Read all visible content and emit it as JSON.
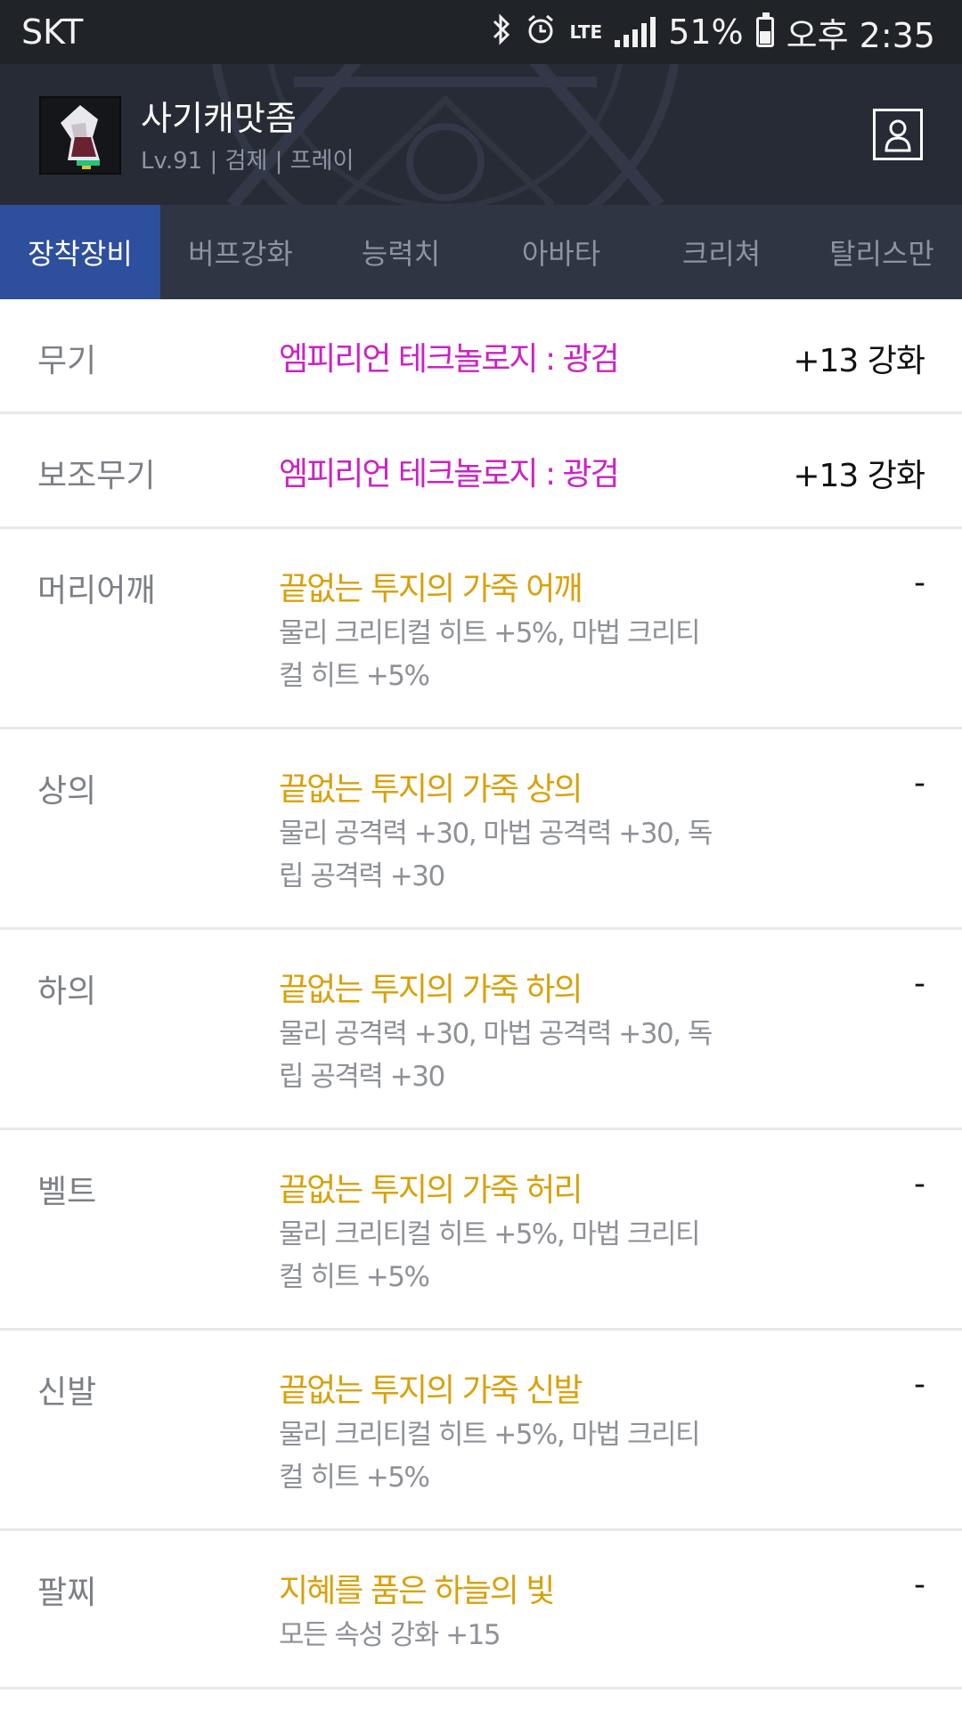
{
  "status_bar": {
    "carrier": "SKT",
    "network": "LTE",
    "battery": "51%",
    "time": "오후 2:35"
  },
  "header": {
    "character_name": "사기캐맛좀",
    "character_info": "Lv.91 | 검제 | 프레이"
  },
  "tabs": [
    {
      "label": "장착장비",
      "active": true
    },
    {
      "label": "버프강화",
      "active": false
    },
    {
      "label": "능력치",
      "active": false
    },
    {
      "label": "아바타",
      "active": false
    },
    {
      "label": "크리쳐",
      "active": false
    },
    {
      "label": "탈리스만",
      "active": false
    }
  ],
  "equipment": [
    {
      "slot": "무기",
      "item": "엠피리언 테크놀로지 : 광검",
      "value": "+13 강화",
      "color": "#cc22c4"
    },
    {
      "slot": "보조무기",
      "item": "엠피리언 테크놀로지 : 광검",
      "value": "+13 강화",
      "color": "#cc22c4"
    },
    {
      "slot": "머리어깨",
      "item": "끝없는 투지의 가죽 어깨",
      "desc1": "물리 크리티컬 히트 +5%, 마법 크리티",
      "desc2": "컬 히트 +5%",
      "value": "-",
      "color": "#d8a10c"
    },
    {
      "slot": "상의",
      "item": "끝없는 투지의 가죽 상의",
      "desc1": "물리 공격력 +30, 마법 공격력 +30, 독",
      "desc2": "립 공격력 +30",
      "value": "-",
      "color": "#d8a10c"
    },
    {
      "slot": "하의",
      "item": "끝없는 투지의 가죽 하의",
      "desc1": "물리 공격력 +30, 마법 공격력 +30, 독",
      "desc2": "립 공격력 +30",
      "value": "-",
      "color": "#d8a10c"
    },
    {
      "slot": "벨트",
      "item": "끝없는 투지의 가죽 허리",
      "desc1": "물리 크리티컬 히트 +5%, 마법 크리티",
      "desc2": "컬 히트 +5%",
      "value": "-",
      "color": "#d8a10c"
    },
    {
      "slot": "신발",
      "item": "끝없는 투지의 가죽 신발",
      "desc1": "물리 크리티컬 히트 +5%, 마법 크리티",
      "desc2": "컬 히트 +5%",
      "value": "-",
      "color": "#d8a10c"
    },
    {
      "slot": "팔찌",
      "item": "지혜를 품은 하늘의 빛",
      "desc1": "모든 속성 강화 +15",
      "value": "-",
      "color": "#d8a10c"
    }
  ]
}
